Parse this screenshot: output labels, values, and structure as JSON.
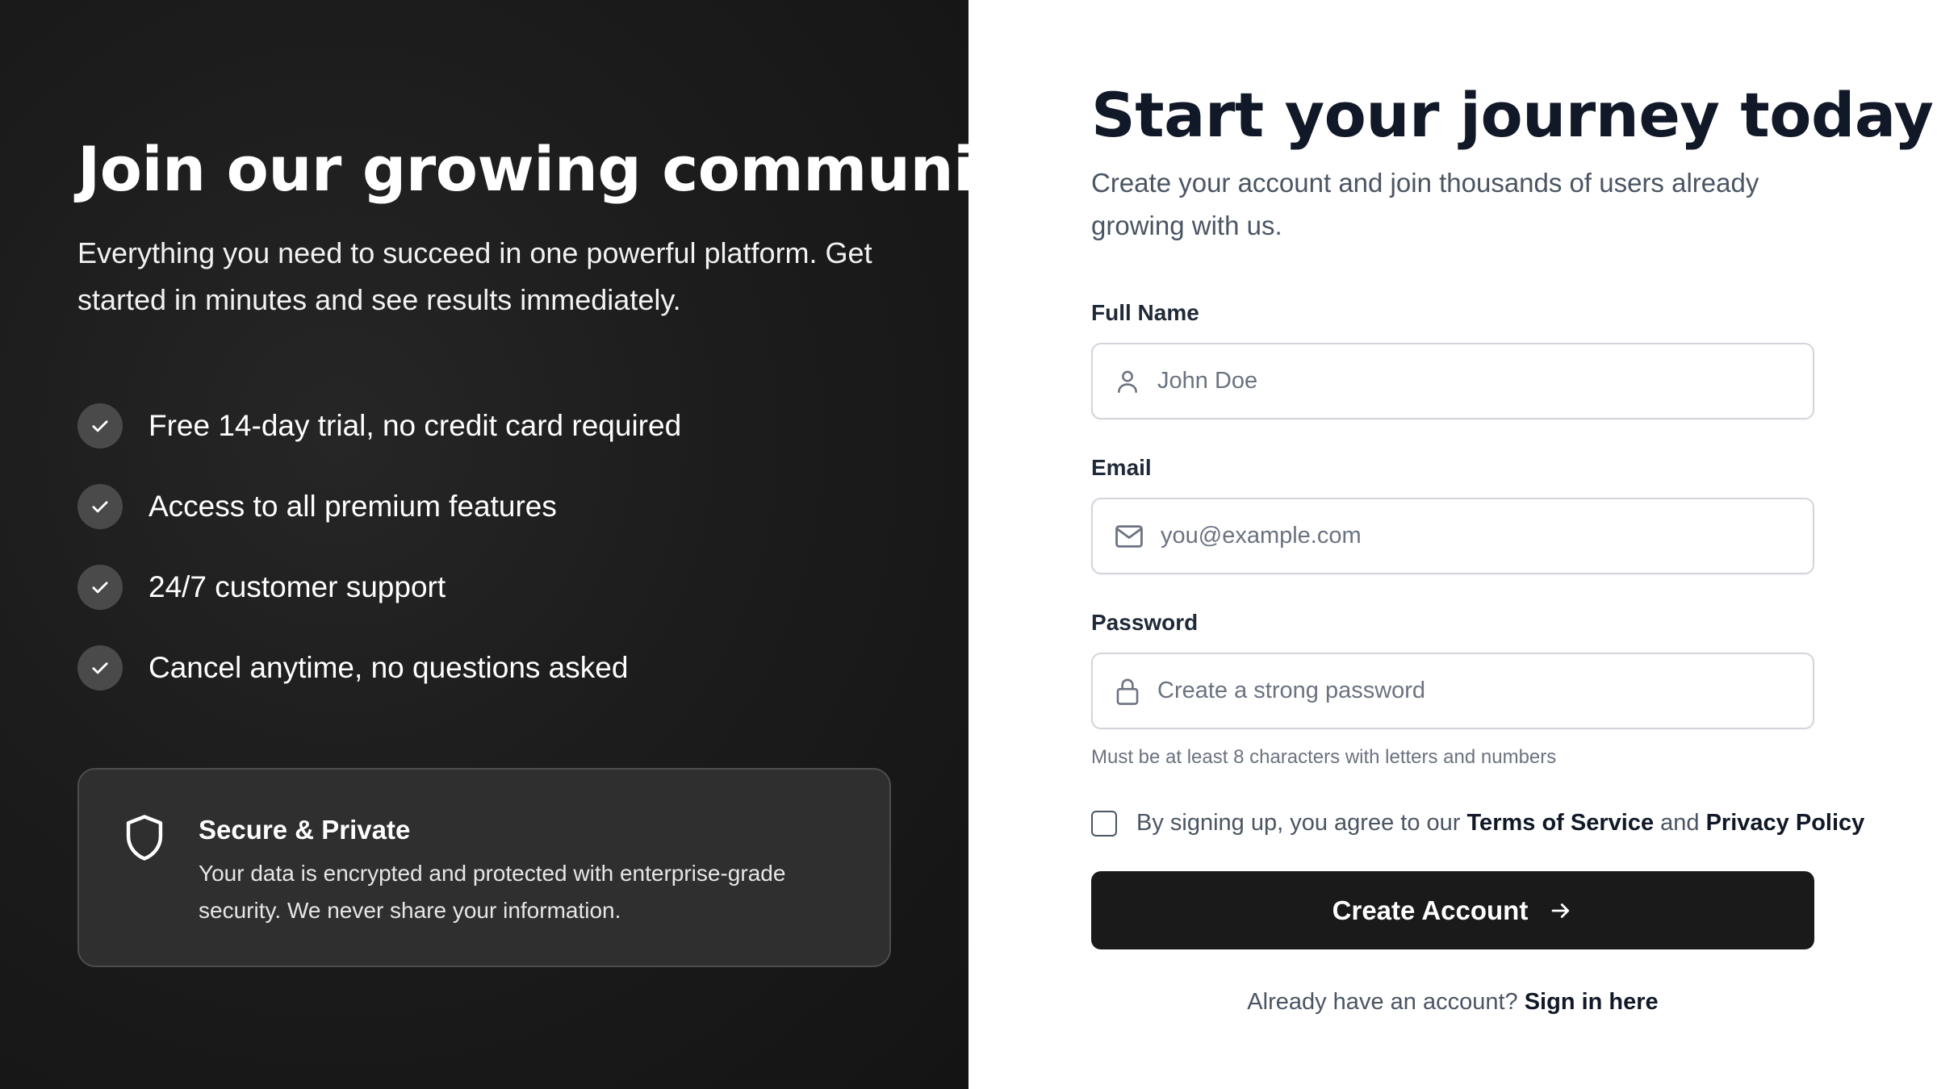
{
  "left": {
    "title": "Join our growing community",
    "subtitle": "Everything you need to succeed in one powerful platform. Get started in minutes and see results immediately.",
    "features": [
      {
        "icon": "check-icon",
        "text": "Free 14-day trial, no credit card required"
      },
      {
        "icon": "check-icon",
        "text": "Access to all premium features"
      },
      {
        "icon": "check-icon",
        "text": "24/7 customer support"
      },
      {
        "icon": "check-icon",
        "text": "Cancel anytime, no questions asked"
      }
    ],
    "secure": {
      "icon": "shield-icon",
      "title": "Secure & Private",
      "description": "Your data is encrypted and protected with enterprise-grade security. We never share your information."
    }
  },
  "form": {
    "title": "Start your journey today",
    "subtitle": "Create your account and join thousands of users already growing with us.",
    "full_name": {
      "label": "Full Name",
      "placeholder": "John Doe",
      "value": "",
      "icon": "user-icon"
    },
    "email": {
      "label": "Email",
      "placeholder": "you@example.com",
      "value": "",
      "icon": "mail-icon"
    },
    "password": {
      "label": "Password",
      "placeholder": "Create a strong password",
      "value": "",
      "icon": "lock-icon",
      "hint": "Must be at least 8 characters with letters and numbers"
    },
    "terms": {
      "checked": false,
      "prefix": "By signing up, you agree to our",
      "terms_link": "Terms of Service",
      "and": "and",
      "privacy_link": "Privacy Policy"
    },
    "submit_label": "Create Account",
    "signin_prompt": "Already have an account?",
    "signin_link": "Sign in here"
  },
  "colors": {
    "left_bg": "#1c1c1c",
    "primary_button": "#1a1a1a",
    "heading": "#111827",
    "muted": "#4b5563"
  }
}
